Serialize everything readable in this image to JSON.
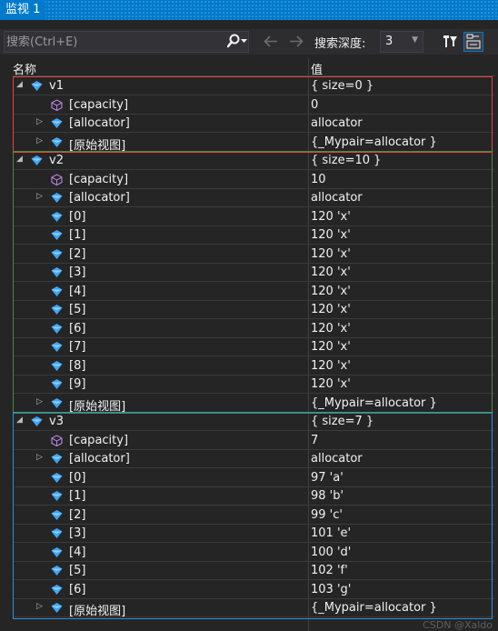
{
  "window": {
    "title": "监视 1"
  },
  "toolbar": {
    "search_placeholder": "搜索(Ctrl+E)",
    "depth_label": "搜索深度:",
    "depth_value": "3",
    "icons": [
      "search-icon",
      "dropdown-arrow-icon",
      "back-arrow-icon",
      "forward-arrow-icon",
      "pin-filter-icon",
      "tab-view-icon"
    ]
  },
  "grid": {
    "headers": {
      "name": "名称",
      "value": "值"
    },
    "rows": [
      {
        "level": 0,
        "expander": "expanded",
        "icon": "blue",
        "name": "v1",
        "value": "{ size=0 }"
      },
      {
        "level": 1,
        "expander": "none",
        "icon": "purple",
        "name": "[capacity]",
        "value": "0"
      },
      {
        "level": 1,
        "expander": "collapsed",
        "icon": "blue",
        "name": "[allocator]",
        "value": "allocator"
      },
      {
        "level": 1,
        "expander": "collapsed",
        "icon": "blue",
        "name": "[原始视图]",
        "value": "{_Mypair=allocator }"
      },
      {
        "level": 0,
        "expander": "expanded",
        "icon": "blue",
        "name": "v2",
        "value": "{ size=10 }"
      },
      {
        "level": 1,
        "expander": "none",
        "icon": "purple",
        "name": "[capacity]",
        "value": "10"
      },
      {
        "level": 1,
        "expander": "collapsed",
        "icon": "blue",
        "name": "[allocator]",
        "value": "allocator"
      },
      {
        "level": 1,
        "expander": "none",
        "icon": "blue",
        "name": "[0]",
        "value": "120 'x'"
      },
      {
        "level": 1,
        "expander": "none",
        "icon": "blue",
        "name": "[1]",
        "value": "120 'x'"
      },
      {
        "level": 1,
        "expander": "none",
        "icon": "blue",
        "name": "[2]",
        "value": "120 'x'"
      },
      {
        "level": 1,
        "expander": "none",
        "icon": "blue",
        "name": "[3]",
        "value": "120 'x'"
      },
      {
        "level": 1,
        "expander": "none",
        "icon": "blue",
        "name": "[4]",
        "value": "120 'x'"
      },
      {
        "level": 1,
        "expander": "none",
        "icon": "blue",
        "name": "[5]",
        "value": "120 'x'"
      },
      {
        "level": 1,
        "expander": "none",
        "icon": "blue",
        "name": "[6]",
        "value": "120 'x'"
      },
      {
        "level": 1,
        "expander": "none",
        "icon": "blue",
        "name": "[7]",
        "value": "120 'x'"
      },
      {
        "level": 1,
        "expander": "none",
        "icon": "blue",
        "name": "[8]",
        "value": "120 'x'"
      },
      {
        "level": 1,
        "expander": "none",
        "icon": "blue",
        "name": "[9]",
        "value": "120 'x'"
      },
      {
        "level": 1,
        "expander": "collapsed",
        "icon": "blue",
        "name": "[原始视图]",
        "value": "{_Mypair=allocator }"
      },
      {
        "level": 0,
        "expander": "expanded",
        "icon": "blue",
        "name": "v3",
        "value": "{ size=7 }"
      },
      {
        "level": 1,
        "expander": "none",
        "icon": "purple",
        "name": "[capacity]",
        "value": "7"
      },
      {
        "level": 1,
        "expander": "collapsed",
        "icon": "blue",
        "name": "[allocator]",
        "value": "allocator"
      },
      {
        "level": 1,
        "expander": "none",
        "icon": "blue",
        "name": "[0]",
        "value": "97 'a'"
      },
      {
        "level": 1,
        "expander": "none",
        "icon": "blue",
        "name": "[1]",
        "value": "98 'b'"
      },
      {
        "level": 1,
        "expander": "none",
        "icon": "blue",
        "name": "[2]",
        "value": "99 'c'"
      },
      {
        "level": 1,
        "expander": "none",
        "icon": "blue",
        "name": "[3]",
        "value": "101 'e'"
      },
      {
        "level": 1,
        "expander": "none",
        "icon": "blue",
        "name": "[4]",
        "value": "100 'd'"
      },
      {
        "level": 1,
        "expander": "none",
        "icon": "blue",
        "name": "[5]",
        "value": "102 'f'"
      },
      {
        "level": 1,
        "expander": "none",
        "icon": "blue",
        "name": "[6]",
        "value": "103 'g'"
      },
      {
        "level": 1,
        "expander": "collapsed",
        "icon": "blue",
        "name": "[原始视图]",
        "value": "{_Mypair=allocator }"
      }
    ]
  },
  "highlight_boxes": [
    {
      "color": "#e0433b",
      "first_row": 0,
      "last_row": 3
    },
    {
      "color": "#4f8a3c",
      "first_row": 4,
      "last_row": 17
    },
    {
      "color": "#2f8fd8",
      "first_row": 18,
      "last_row": 28
    }
  ],
  "colors": {
    "accent": "#007acc",
    "background": "#252526",
    "icon_blue": "#3ea6f5",
    "icon_purple": "#b180d7"
  },
  "watermark": "CSDN @Xaldo"
}
